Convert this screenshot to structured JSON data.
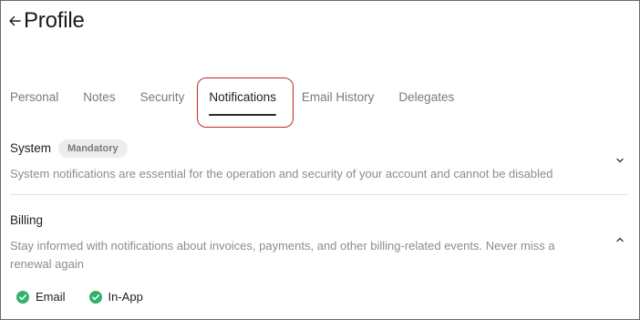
{
  "header": {
    "title": "Profile",
    "back_icon": "arrow-left-icon"
  },
  "tabs": [
    {
      "label": "Personal",
      "active": false
    },
    {
      "label": "Notes",
      "active": false
    },
    {
      "label": "Security",
      "active": false
    },
    {
      "label": "Notifications",
      "active": true
    },
    {
      "label": "Email History",
      "active": false
    },
    {
      "label": "Delegates",
      "active": false
    }
  ],
  "sections": {
    "system": {
      "title": "System",
      "badge": "Mandatory",
      "description": "System notifications are essential for the operation and security of your account and cannot be disabled",
      "expanded": false
    },
    "billing": {
      "title": "Billing",
      "description": "Stay informed with notifications about invoices, payments, and other billing-related events. Never miss a renewal again",
      "expanded": true,
      "channels": [
        {
          "label": "Email",
          "checked": true
        },
        {
          "label": "In-App",
          "checked": true
        }
      ]
    }
  },
  "colors": {
    "accent_green": "#2fb36a",
    "highlight_red": "#c62828",
    "text_primary": "#1f1f1f",
    "text_secondary": "#8c8c8c"
  }
}
